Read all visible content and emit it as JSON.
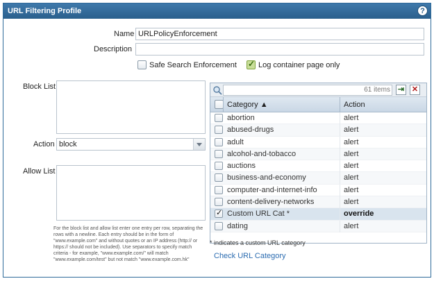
{
  "dialog": {
    "title": "URL Filtering Profile",
    "help": "?"
  },
  "form": {
    "name_label": "Name",
    "name_value": "URLPolicyEnforcement",
    "description_label": "Description",
    "description_value": "",
    "safe_search_label": "Safe Search Enforcement",
    "safe_search_checked": false,
    "log_container_label": "Log container page only",
    "log_container_checked": true,
    "block_list_label": "Block List",
    "action_label": "Action",
    "action_value": "block",
    "allow_list_label": "Allow List",
    "help_text": "For the block list and allow list enter one entry per row, separating the rows with a newline. Each entry should be in the form of \"www.example.com\" and without quotes or an IP address (http:// or https:// should not be included). Use separators to specify match criteria - for example, \"www.example.com/\" will match \"www.example.com/test\" but not match \"www.example.com.hk\""
  },
  "grid": {
    "items_count": "61 items",
    "columns": {
      "category": "Category ▲",
      "action": "Action"
    },
    "rows": [
      {
        "category": "abortion",
        "action": "alert",
        "checked": false
      },
      {
        "category": "abused-drugs",
        "action": "alert",
        "checked": false
      },
      {
        "category": "adult",
        "action": "alert",
        "checked": false
      },
      {
        "category": "alcohol-and-tobacco",
        "action": "alert",
        "checked": false
      },
      {
        "category": "auctions",
        "action": "alert",
        "checked": false
      },
      {
        "category": "business-and-economy",
        "action": "alert",
        "checked": false
      },
      {
        "category": "computer-and-internet-info",
        "action": "alert",
        "checked": false
      },
      {
        "category": "content-delivery-networks",
        "action": "alert",
        "checked": false
      },
      {
        "category": "Custom URL Cat *",
        "action": "override",
        "checked": true
      },
      {
        "category": "dating",
        "action": "alert",
        "checked": false
      }
    ],
    "legend": "* indicates a custom URL category",
    "check_link": "Check URL Category"
  },
  "colors": {
    "title_bar": "#2f6a9a",
    "link": "#2a6bb0"
  },
  "icons": {
    "help": "help-icon",
    "search": "search-icon",
    "go": "arrow-right-icon",
    "clear": "close-icon",
    "sort": "sort-asc-icon"
  }
}
